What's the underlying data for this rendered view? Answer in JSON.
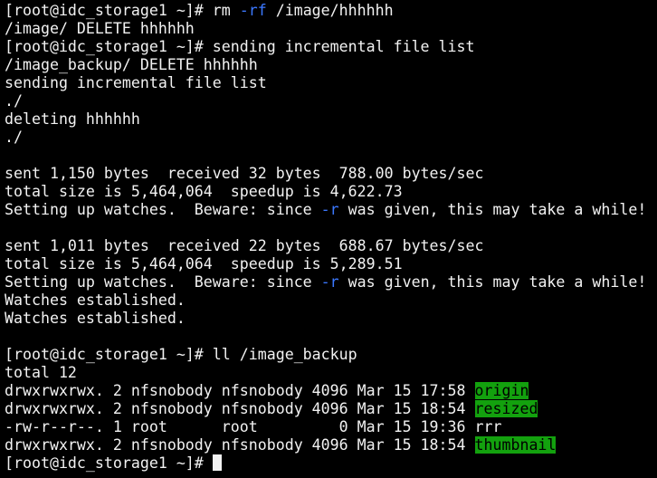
{
  "terminal": {
    "lines": [
      {
        "segments": [
          {
            "text": "[root@idc_storage1 ~]# rm "
          },
          {
            "text": "-rf",
            "style": "flag"
          },
          {
            "text": " /image/hhhhhh"
          }
        ]
      },
      {
        "segments": [
          {
            "text": "/image/ DELETE hhhhhh"
          }
        ]
      },
      {
        "segments": [
          {
            "text": "[root@idc_storage1 ~]# sending incremental file list"
          }
        ]
      },
      {
        "segments": [
          {
            "text": "/image_backup/ DELETE hhhhhh"
          }
        ]
      },
      {
        "segments": [
          {
            "text": "sending incremental file list"
          }
        ]
      },
      {
        "segments": [
          {
            "text": "./"
          }
        ]
      },
      {
        "segments": [
          {
            "text": "deleting hhhhhh"
          }
        ]
      },
      {
        "segments": [
          {
            "text": "./"
          }
        ]
      },
      {
        "segments": [
          {
            "text": ""
          }
        ]
      },
      {
        "segments": [
          {
            "text": "sent 1,150 bytes  received 32 bytes  788.00 bytes/sec"
          }
        ]
      },
      {
        "segments": [
          {
            "text": "total size is 5,464,064  speedup is 4,622.73"
          }
        ]
      },
      {
        "segments": [
          {
            "text": "Setting up watches.  Beware: since "
          },
          {
            "text": "-r",
            "style": "flag"
          },
          {
            "text": " was given, this may take a while!"
          }
        ]
      },
      {
        "segments": [
          {
            "text": ""
          }
        ]
      },
      {
        "segments": [
          {
            "text": "sent 1,011 bytes  received 22 bytes  688.67 bytes/sec"
          }
        ]
      },
      {
        "segments": [
          {
            "text": "total size is 5,464,064  speedup is 5,289.51"
          }
        ]
      },
      {
        "segments": [
          {
            "text": "Setting up watches.  Beware: since "
          },
          {
            "text": "-r",
            "style": "flag"
          },
          {
            "text": " was given, this may take a while!"
          }
        ]
      },
      {
        "segments": [
          {
            "text": "Watches established."
          }
        ]
      },
      {
        "segments": [
          {
            "text": "Watches established."
          }
        ]
      },
      {
        "segments": [
          {
            "text": ""
          }
        ]
      },
      {
        "segments": [
          {
            "text": "[root@idc_storage1 ~]# ll /image_backup"
          }
        ]
      },
      {
        "segments": [
          {
            "text": "total 12"
          }
        ]
      },
      {
        "segments": [
          {
            "text": "drwxrwxrwx. 2 nfsnobody nfsnobody 4096 Mar 15 17:58 "
          },
          {
            "text": "origin",
            "style": "hl"
          }
        ]
      },
      {
        "segments": [
          {
            "text": "drwxrwxrwx. 2 nfsnobody nfsnobody 4096 Mar 15 18:54 "
          },
          {
            "text": "resized",
            "style": "hl"
          }
        ]
      },
      {
        "segments": [
          {
            "text": "-rw-r--r--. 1 root      root         0 Mar 15 19:36 rrr"
          }
        ]
      },
      {
        "segments": [
          {
            "text": "drwxrwxrwx. 2 nfsnobody nfsnobody 4096 Mar 15 18:54 "
          },
          {
            "text": "thumbnail",
            "style": "hl"
          }
        ]
      }
    ],
    "prompt": "[root@idc_storage1 ~]# ",
    "colors": {
      "background": "#000000",
      "foreground": "#f2f2f2",
      "flag": "#3b78ff",
      "directory_highlight": "#13a10e"
    }
  }
}
